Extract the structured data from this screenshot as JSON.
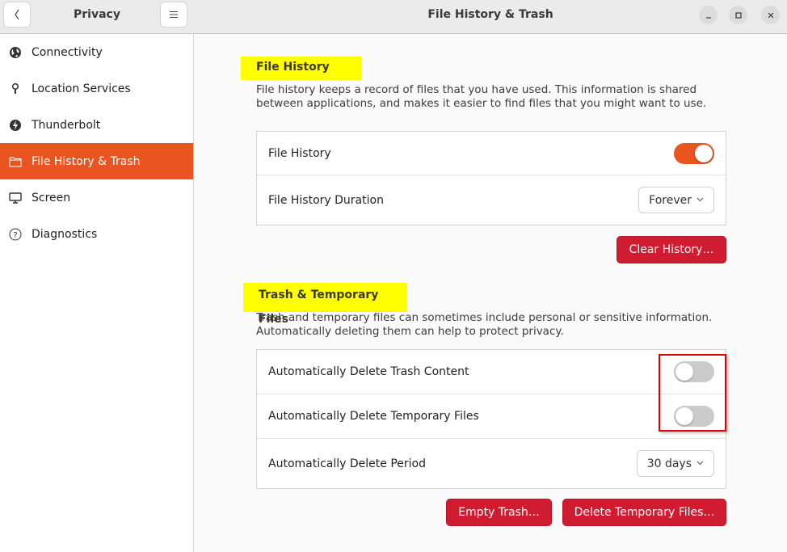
{
  "sidebar": {
    "title": "Privacy",
    "back_icon": "chevron-left-icon",
    "menu_icon": "hamburger-menu-icon",
    "items": [
      {
        "label": "Connectivity",
        "icon": "globe-icon",
        "active": false
      },
      {
        "label": "Location Services",
        "icon": "location-pin-icon",
        "active": false
      },
      {
        "label": "Thunderbolt",
        "icon": "thunderbolt-icon",
        "active": false
      },
      {
        "label": "File History & Trash",
        "icon": "folder-icon",
        "active": true
      },
      {
        "label": "Screen",
        "icon": "monitor-icon",
        "active": false
      },
      {
        "label": "Diagnostics",
        "icon": "help-circle-icon",
        "active": false
      }
    ]
  },
  "header": {
    "title": "File History & Trash",
    "minimize_icon": "minimize-icon",
    "maximize_icon": "maximize-icon",
    "close_icon": "close-icon"
  },
  "file_history": {
    "title": "File History",
    "description_line1": "File history keeps a record of files that you have used. This information is shared",
    "description_line2": "between applications, and makes it easier to find files that you might want to use.",
    "toggle_label": "File History",
    "toggle_on": true,
    "duration_label": "File History Duration",
    "duration_value": "Forever",
    "clear_button": "Clear History…"
  },
  "trash": {
    "title": "Trash & Temporary Files",
    "description_line1": "Trash and temporary files can sometimes include personal or sensitive information.",
    "description_line2": "Automatically deleting them can help to protect privacy.",
    "auto_trash_label": "Automatically Delete Trash Content",
    "auto_trash_on": false,
    "auto_temp_label": "Automatically Delete Temporary Files",
    "auto_temp_on": false,
    "period_label": "Automatically Delete Period",
    "period_value": "30 days",
    "empty_trash_button": "Empty Trash…",
    "delete_temp_button": "Delete Temporary Files…"
  },
  "colors": {
    "accent": "#e95420",
    "destructive": "#d01c31",
    "highlight": "#ffff00",
    "annotation_box": "#e00000"
  }
}
